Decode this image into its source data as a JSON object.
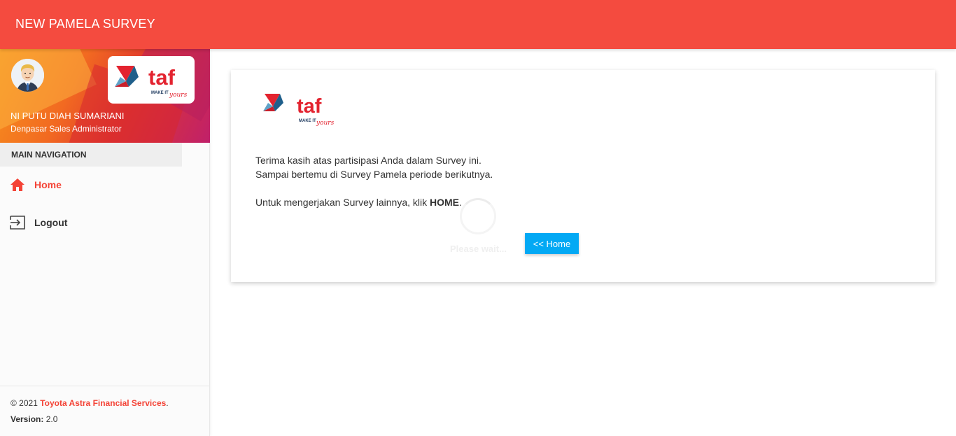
{
  "app": {
    "title": "NEW PAMELA SURVEY"
  },
  "user": {
    "name": "NI PUTU DIAH SUMARIANI",
    "role": "Denpasar Sales Administrator"
  },
  "logo": {
    "text": "taf",
    "tagline_prefix": "MAKE IT",
    "tagline_script": "yours"
  },
  "nav": {
    "header": "MAIN NAVIGATION",
    "items": [
      {
        "label": "Home",
        "icon": "home-icon",
        "active": true
      },
      {
        "label": "Logout",
        "icon": "logout-icon",
        "active": false
      }
    ]
  },
  "footer": {
    "copyright_prefix": "© 2021",
    "company": "Toyota Astra Financial Services",
    "period": ".",
    "version_label": "Version:",
    "version_value": "2.0"
  },
  "content": {
    "line1": "Terima kasih atas partisipasi Anda dalam Survey ini.",
    "line2": "Sampai bertemu di Survey Pamela periode berikutnya.",
    "line3_prefix": "Untuk mengerjakan Survey lainnya, klik",
    "line3_bold": "HOME",
    "line3_suffix": ".",
    "loading_text": "Please wait...",
    "home_button": "<< Home"
  },
  "colors": {
    "primary": "#f44b3f",
    "accent_red": "#f44336",
    "button": "#03a9f4"
  }
}
